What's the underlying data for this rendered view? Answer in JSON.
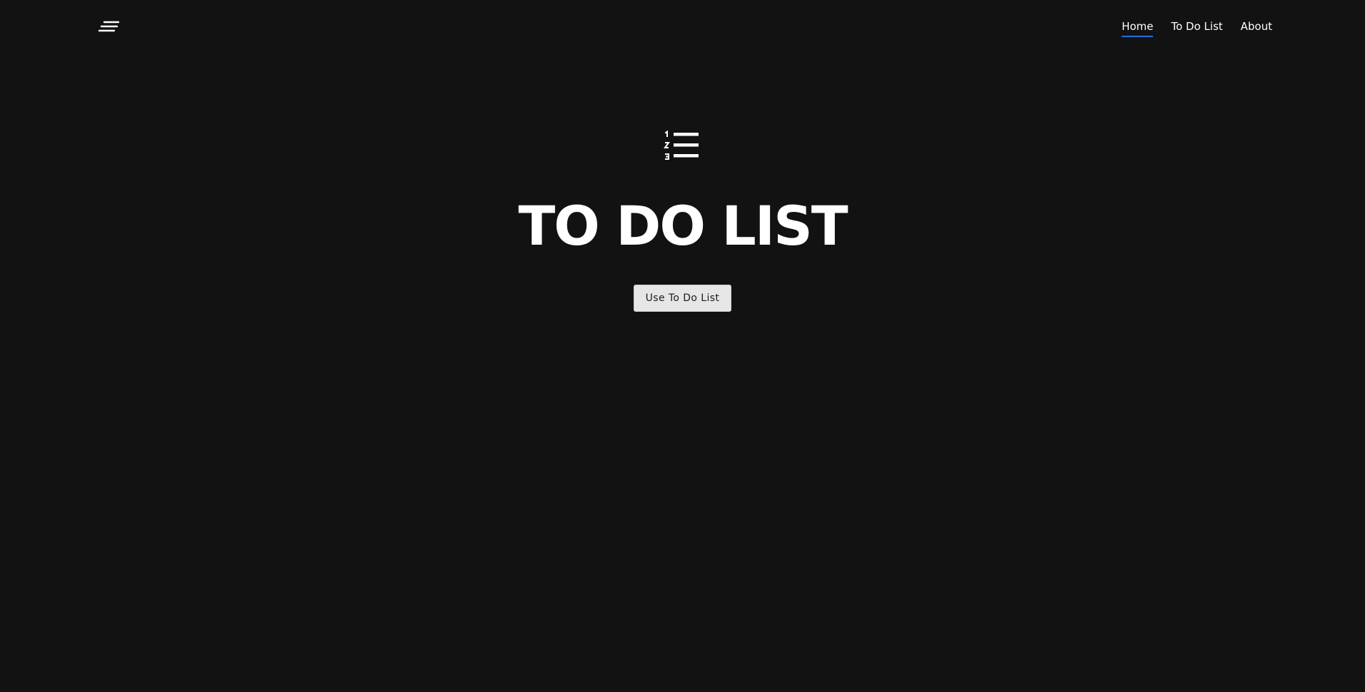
{
  "header": {
    "logo_icon": "menu-lines-icon",
    "nav": [
      {
        "label": "Home",
        "active": true
      },
      {
        "label": "To Do List",
        "active": false
      },
      {
        "label": "About",
        "active": false
      }
    ],
    "active_color": "#1e6fe0"
  },
  "hero": {
    "icon": "numbered-list-icon",
    "title": "TO DO LIST",
    "cta_label": "Use To Do List"
  },
  "colors": {
    "background": "#121212",
    "text": "#ffffff",
    "button_bg": "#e6e6e6"
  }
}
